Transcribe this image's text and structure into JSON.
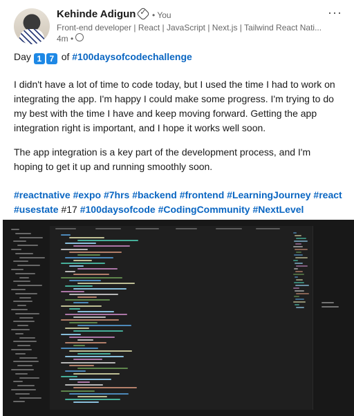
{
  "post": {
    "author": "Kehinde Adigun",
    "badge_icon": "verified-shield-icon",
    "you_label": "• You",
    "headline": "Front-end developer | React | JavaScript | Next.js | Tailwind React Nati...",
    "time": "4m •",
    "visibility_icon": "globe-icon",
    "menu_label": "···",
    "day_line": {
      "prefix": "Day",
      "digit1": "1",
      "digit2": "7",
      "of": "of",
      "hashtag": "#100daysofcodechallenge"
    },
    "paragraph1": "I didn't have a lot of time to code today, but I used the time I had to work on integrating the app. I'm happy I could make some progress. I'm trying to do my best with the time I have and keep moving forward. Getting the app integration right is important, and I hope it works well soon.",
    "paragraph2": "The app integration is a key part of the development process, and I'm hoping to get it up and running smoothly soon.",
    "tags": [
      "#reactnative",
      "#expo",
      "#7hrs",
      "#backend",
      "#frontend",
      "#LearningJourney",
      "#react",
      "#usestate",
      "#17",
      "#100daysofcode",
      "#CodingCommunity",
      "#NextLevel"
    ],
    "tag_colors": {
      "hashtag": "#0a66c2",
      "plain": "#191919"
    }
  },
  "screenshot": {
    "kind": "code-editor-dark-theme",
    "colors": {
      "bg": "#1f1f1f",
      "panel": "#181818",
      "accent": "#0a66c2"
    }
  }
}
